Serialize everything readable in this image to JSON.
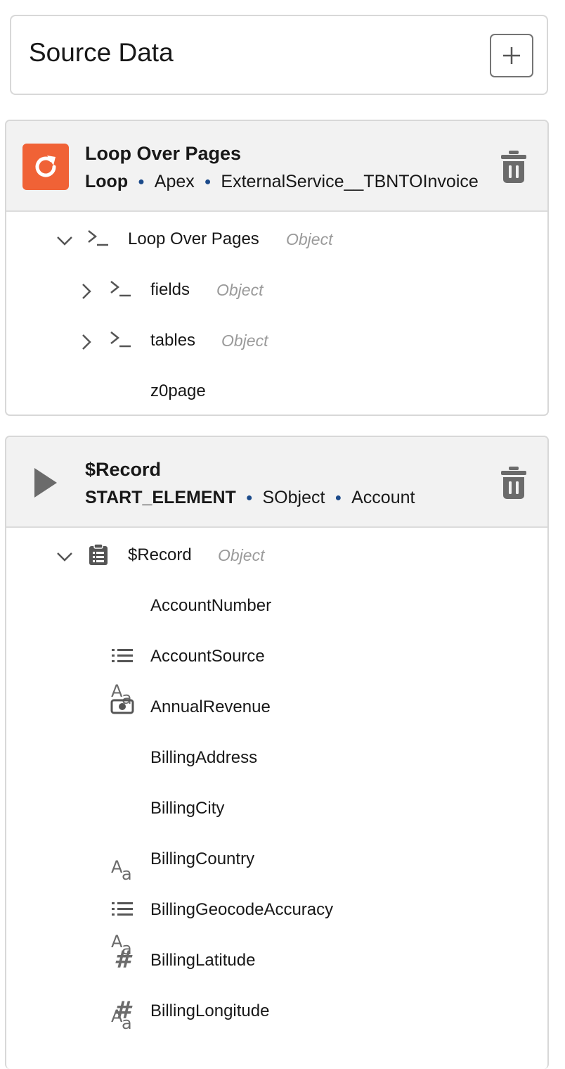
{
  "source_data": {
    "title": "Source Data",
    "add_button_icon": "plus-icon"
  },
  "loop_section": {
    "title": "Loop Over Pages",
    "meta_type": "Loop",
    "meta_source": "Apex",
    "meta_object": "ExternalService__TBNTOInvoice",
    "icon": "loop-refresh-icon",
    "icon_color": "#f06236",
    "root": {
      "label": "Loop Over Pages",
      "type": "Object"
    },
    "children": [
      {
        "label": "fields",
        "type": "Object"
      },
      {
        "label": "tables",
        "type": "Object"
      },
      {
        "label": "z0page",
        "type": ""
      }
    ]
  },
  "record_section": {
    "title": "$Record",
    "meta_type": "START_ELEMENT",
    "meta_source": "SObject",
    "meta_object": "Account",
    "icon": "play-triangle-icon",
    "root": {
      "label": "$Record",
      "type": "Object"
    },
    "fields": [
      {
        "label": "AccountNumber",
        "icon": "text-icon"
      },
      {
        "label": "AccountSource",
        "icon": "picklist-icon"
      },
      {
        "label": "AnnualRevenue",
        "icon": "currency-icon"
      },
      {
        "label": "BillingAddress",
        "icon": "text-icon"
      },
      {
        "label": "BillingCity",
        "icon": "text-icon"
      },
      {
        "label": "BillingCountry",
        "icon": "text-icon"
      },
      {
        "label": "BillingGeocodeAccuracy",
        "icon": "picklist-icon"
      },
      {
        "label": "BillingLatitude",
        "icon": "number-icon"
      },
      {
        "label": "BillingLongitude",
        "icon": "number-icon"
      }
    ]
  }
}
